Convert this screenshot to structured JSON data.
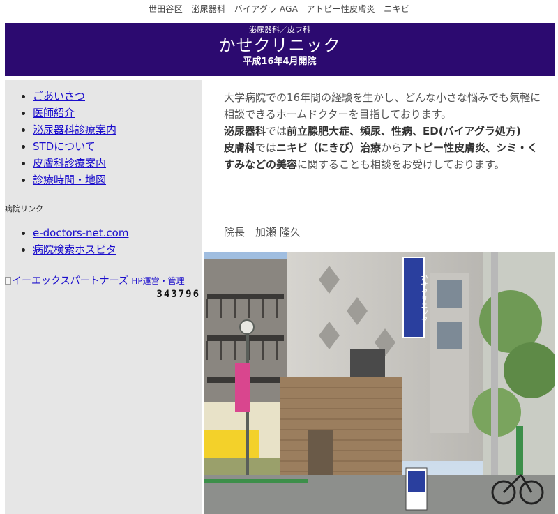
{
  "keywords": "世田谷区　泌尿器科　バイアグラ AGA　アトピー性皮膚炎　ニキビ",
  "header": {
    "subtitle": "泌尿器科／皮フ科",
    "title": "かせクリニック",
    "opened": "平成16年4月開院"
  },
  "nav": {
    "items": [
      {
        "label": "ごあいさつ"
      },
      {
        "label": "医師紹介"
      },
      {
        "label": "泌尿器科診療案内"
      },
      {
        "label": "STDについて"
      },
      {
        "label": "皮膚科診療案内"
      },
      {
        "label": "診療時間・地図"
      }
    ]
  },
  "hospital_links": {
    "title": "病院リンク",
    "items": [
      {
        "label": "e-doctors-net.com"
      },
      {
        "label": "病院検索ホスピタ"
      }
    ]
  },
  "banner": {
    "alt_text": "イーエックスパートナーズ",
    "link_text": "HP運営・管理"
  },
  "counter": "343796",
  "content": {
    "p1": "大学病院での16年間の経験を生かし、どんな小さな悩みでも気軽に相談できるホームドクターを目指しております。",
    "uro_dept": "泌尿器科",
    "uro_mid": "では",
    "uro_items": "前立腺肥大症、頻尿、性病、ED(バイアグラ処方)",
    "derm_dept": "皮膚科",
    "derm_mid": "では",
    "derm_items1": "ニキビ（にきび）治療",
    "derm_mid2": "から",
    "derm_items2": "アトピー性皮膚炎、シミ・くすみなどの美容",
    "derm_tail": "に関することも相談をお受けしております。",
    "director": "院長　加瀬 隆久"
  },
  "photo_sign": "かせクリニック",
  "colors": {
    "header_bg": "#2c0a70",
    "sidebar_bg": "#e6e6e6",
    "link": "#1a0dcc"
  }
}
